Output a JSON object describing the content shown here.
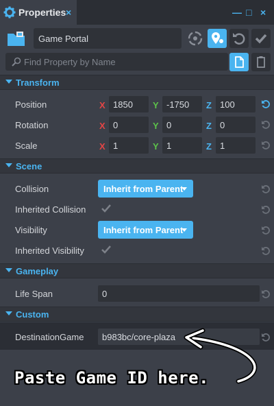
{
  "panel": {
    "title": "Properties",
    "close": "×",
    "minimize": "—",
    "maximize": "□",
    "window_close": "×"
  },
  "object": {
    "name": "Game Portal",
    "search_placeholder": "Find Property by Name"
  },
  "sections": {
    "transform": "Transform",
    "scene": "Scene",
    "gameplay": "Gameplay",
    "custom": "Custom"
  },
  "axes": {
    "x": "X",
    "y": "Y",
    "z": "Z"
  },
  "transform": {
    "position": {
      "label": "Position",
      "x": "1850",
      "y": "-1750",
      "z": "100"
    },
    "rotation": {
      "label": "Rotation",
      "x": "0",
      "y": "0",
      "z": "0"
    },
    "scale": {
      "label": "Scale",
      "x": "1",
      "y": "1",
      "z": "1"
    }
  },
  "scene": {
    "collision": {
      "label": "Collision",
      "value": "Inherit from Parent"
    },
    "inherited_collision": {
      "label": "Inherited Collision"
    },
    "visibility": {
      "label": "Visibility",
      "value": "Inherit from Parent"
    },
    "inherited_visibility": {
      "label": "Inherited Visibility"
    }
  },
  "gameplay": {
    "life_span": {
      "label": "Life Span",
      "value": "0"
    }
  },
  "custom": {
    "destination_game": {
      "label": "DestinationGame",
      "value": "b983bc/core-plaza"
    }
  },
  "annotation": "Paste Game ID here.",
  "colors": {
    "accent": "#4ab4f0",
    "x_axis": "#e44545",
    "y_axis": "#5cc24a",
    "z_axis": "#4ab4f0",
    "panel_bg": "#3c4049"
  }
}
